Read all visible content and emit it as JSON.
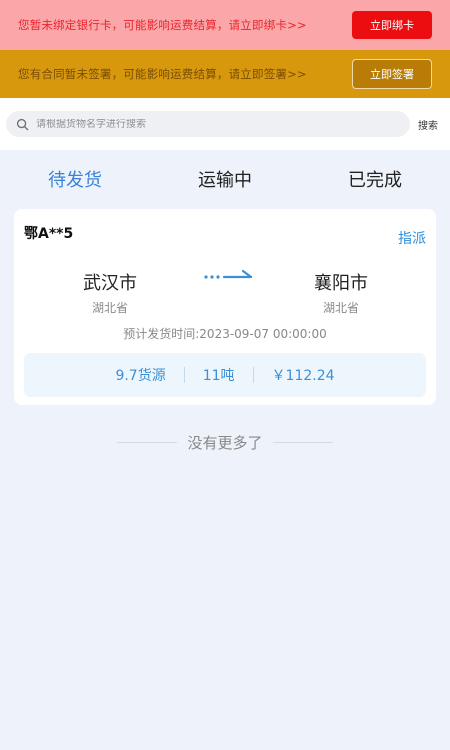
{
  "alerts": {
    "bank": {
      "text": "您暂未绑定银行卡，可能影响运费结算，请立即绑卡>>",
      "button": "立即绑卡"
    },
    "contract": {
      "text": "您有合同暂未签署，可能影响运费结算，请立即签署>>",
      "button": "立即签署"
    }
  },
  "search": {
    "placeholder": "请根据货物名字进行搜索",
    "button": "搜索"
  },
  "tabs": [
    {
      "label": "待发货",
      "active": true
    },
    {
      "label": "运输中",
      "active": false
    },
    {
      "label": "已完成",
      "active": false
    }
  ],
  "orders": [
    {
      "plate": "鄂A**5",
      "action": "指派",
      "from": {
        "city": "武汉市",
        "province": "湖北省"
      },
      "to": {
        "city": "襄阳市",
        "province": "湖北省"
      },
      "ship_time": "预计发货时间:2023-09-07 00:00:00",
      "goods": "9.7货源",
      "weight": "11吨",
      "price": "￥112.24"
    }
  ],
  "footer": {
    "no_more": "没有更多了"
  },
  "colors": {
    "accent": "#3b82d6",
    "alert_red": "#ec0d10",
    "alert_orange": "#d7980d"
  }
}
